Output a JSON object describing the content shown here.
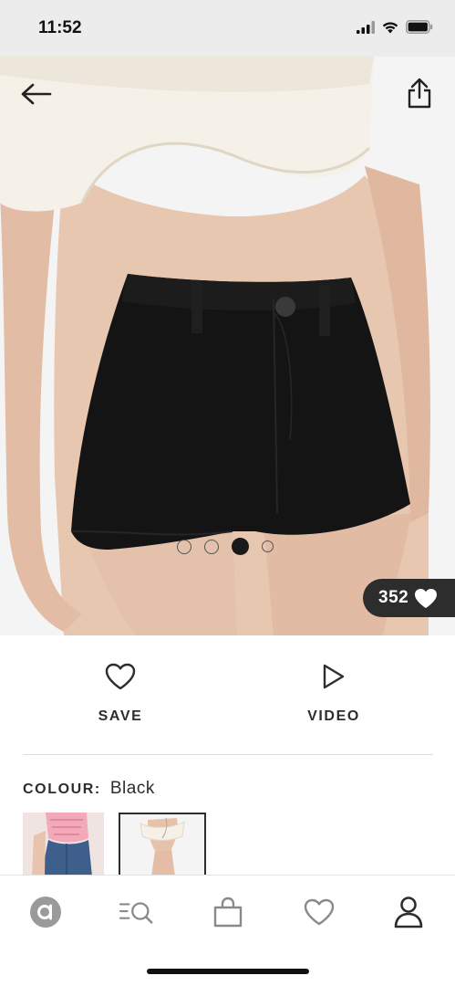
{
  "status_bar": {
    "time": "11:52",
    "icons": [
      "signal-icon",
      "wifi-icon",
      "battery-icon"
    ]
  },
  "hero": {
    "icons": {
      "back": "arrow-left-icon",
      "share": "share-icon"
    },
    "carousel": {
      "count": 4,
      "active_index": 2
    },
    "likes": {
      "count": "352",
      "icon": "heart-filled-icon"
    }
  },
  "actions": {
    "save": {
      "label": "SAVE",
      "icon": "heart-outline-icon"
    },
    "video": {
      "label": "VIDEO",
      "icon": "play-outline-icon"
    }
  },
  "colour": {
    "label": "COLOUR:",
    "value": "Black"
  },
  "bottom_nav": {
    "items": [
      "home-icon",
      "search-icon",
      "bag-icon",
      "saved-icon",
      "account-icon"
    ]
  },
  "colors": {
    "text": "#2d2d2d",
    "pill": "#2d2d2d",
    "garment": "#141414",
    "top": "#f4efe6",
    "skin": "#e6c3ad"
  }
}
